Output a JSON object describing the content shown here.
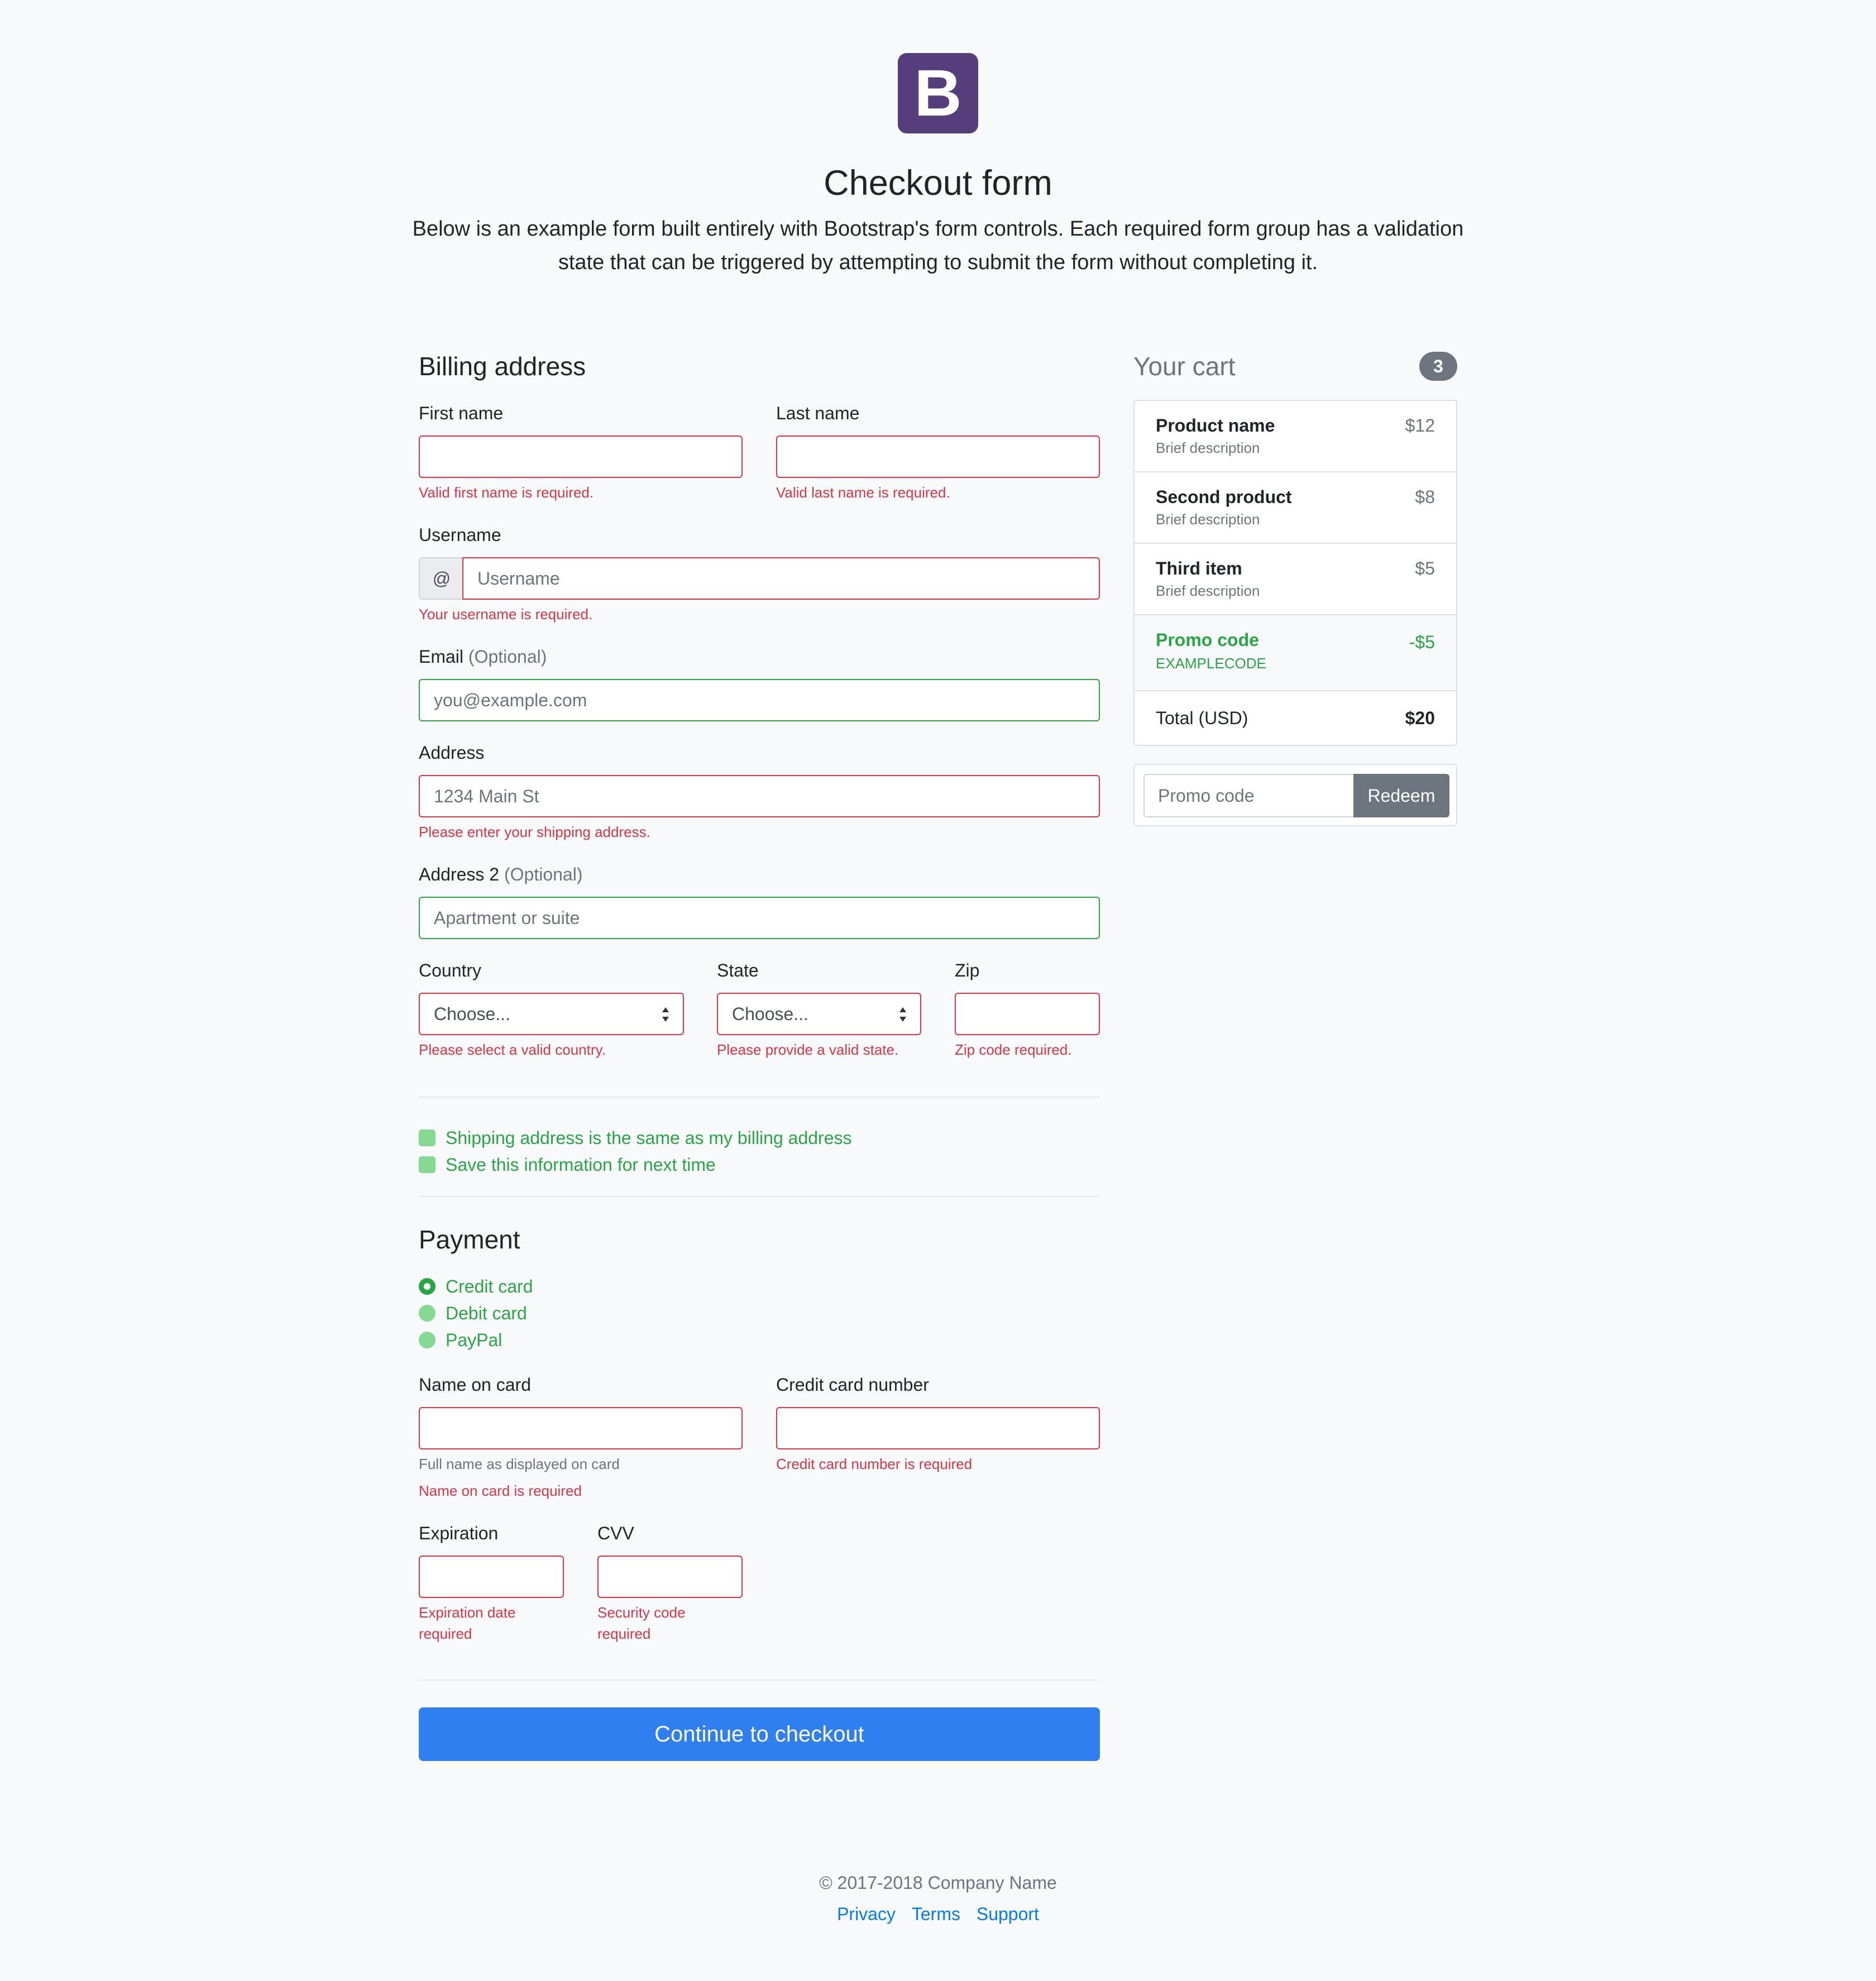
{
  "header": {
    "logo_letter": "B",
    "title": "Checkout form",
    "lead": "Below is an example form built entirely with Bootstrap's form controls. Each required form group has a validation state that can be triggered by attempting to submit the form without completing it."
  },
  "billing": {
    "heading": "Billing address",
    "first_name_label": "First name",
    "first_name_error": "Valid first name is required.",
    "last_name_label": "Last name",
    "last_name_error": "Valid last name is required.",
    "username_label": "Username",
    "username_prefix": "@",
    "username_placeholder": "Username",
    "username_error": "Your username is required.",
    "email_label": "Email",
    "email_optional": "(Optional)",
    "email_placeholder": "you@example.com",
    "address_label": "Address",
    "address_placeholder": "1234 Main St",
    "address_error": "Please enter your shipping address.",
    "address2_label": "Address 2",
    "address2_optional": "(Optional)",
    "address2_placeholder": "Apartment or suite",
    "country_label": "Country",
    "country_value": "Choose...",
    "country_error": "Please select a valid country.",
    "state_label": "State",
    "state_value": "Choose...",
    "state_error": "Please provide a valid state.",
    "zip_label": "Zip",
    "zip_error": "Zip code required.",
    "same_address_label": "Shipping address is the same as my billing address",
    "save_info_label": "Save this information for next time"
  },
  "payment": {
    "heading": "Payment",
    "options": [
      "Credit card",
      "Debit card",
      "PayPal"
    ],
    "selected": "Credit card",
    "name_label": "Name on card",
    "name_help": "Full name as displayed on card",
    "name_error": "Name on card is required",
    "number_label": "Credit card number",
    "number_error": "Credit card number is required",
    "expiration_label": "Expiration",
    "expiration_error_line1": "Expiration date",
    "expiration_error_line2": "required",
    "cvv_label": "CVV",
    "cvv_error_line1": "Security code",
    "cvv_error_line2": "required",
    "submit_label": "Continue to checkout"
  },
  "cart": {
    "heading": "Your cart",
    "count": "3",
    "items": [
      {
        "name": "Product name",
        "desc": "Brief description",
        "price": "$12"
      },
      {
        "name": "Second product",
        "desc": "Brief description",
        "price": "$8"
      },
      {
        "name": "Third item",
        "desc": "Brief description",
        "price": "$5"
      }
    ],
    "promo": {
      "name": "Promo code",
      "code": "EXAMPLECODE",
      "amount": "-$5"
    },
    "total_label": "Total (USD)",
    "total_value": "$20",
    "promo_placeholder": "Promo code",
    "redeem_label": "Redeem"
  },
  "footer": {
    "copyright": "© 2017-2018 Company Name",
    "links": [
      "Privacy",
      "Terms",
      "Support"
    ]
  },
  "colors": {
    "brand": "#563d7c",
    "primary": "#007bff",
    "danger": "#dc3545",
    "success": "#28a745",
    "secondary": "#6c757d"
  }
}
